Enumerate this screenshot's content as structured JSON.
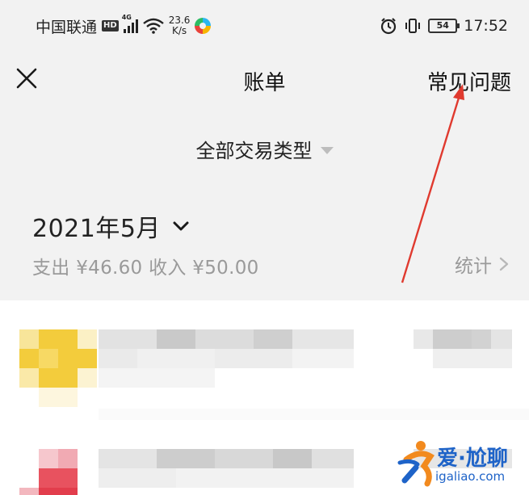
{
  "status_bar": {
    "carrier": "中国联通",
    "hd_badge": "HD",
    "network_gen": "4G",
    "speed_value": "23.6",
    "speed_unit": "K/s",
    "battery_level": "54",
    "time": "17:52",
    "icons": [
      "hd-icon",
      "signal-icon",
      "wifi-icon",
      "app-icon",
      "alarm-icon",
      "vibrate-icon",
      "battery-icon"
    ]
  },
  "header": {
    "title": "账单",
    "close_icon": "close-icon",
    "faq_label": "常见问题"
  },
  "filter": {
    "label": "全部交易类型",
    "icon": "caret-down-icon"
  },
  "month": {
    "label": "2021年5月",
    "icon": "chevron-down-icon"
  },
  "summary": {
    "text": "支出 ¥46.60 收入 ¥50.00",
    "expense": "¥46.60",
    "income": "¥50.00"
  },
  "stats": {
    "label": "统计",
    "icon": "chevron-right-icon"
  },
  "colors": {
    "background": "#f2f2f2",
    "list_background": "#ffffff",
    "primary_text": "#111111",
    "secondary_text": "#9a9a9a",
    "annotation_red": "#e03a2f",
    "watermark_blue": "#1e63c8",
    "pixel_yellow": "#f3cc3c",
    "pixel_red": "#e8525f"
  },
  "watermark": {
    "text": "爱·尬聊",
    "domain": "igaliao.com"
  }
}
